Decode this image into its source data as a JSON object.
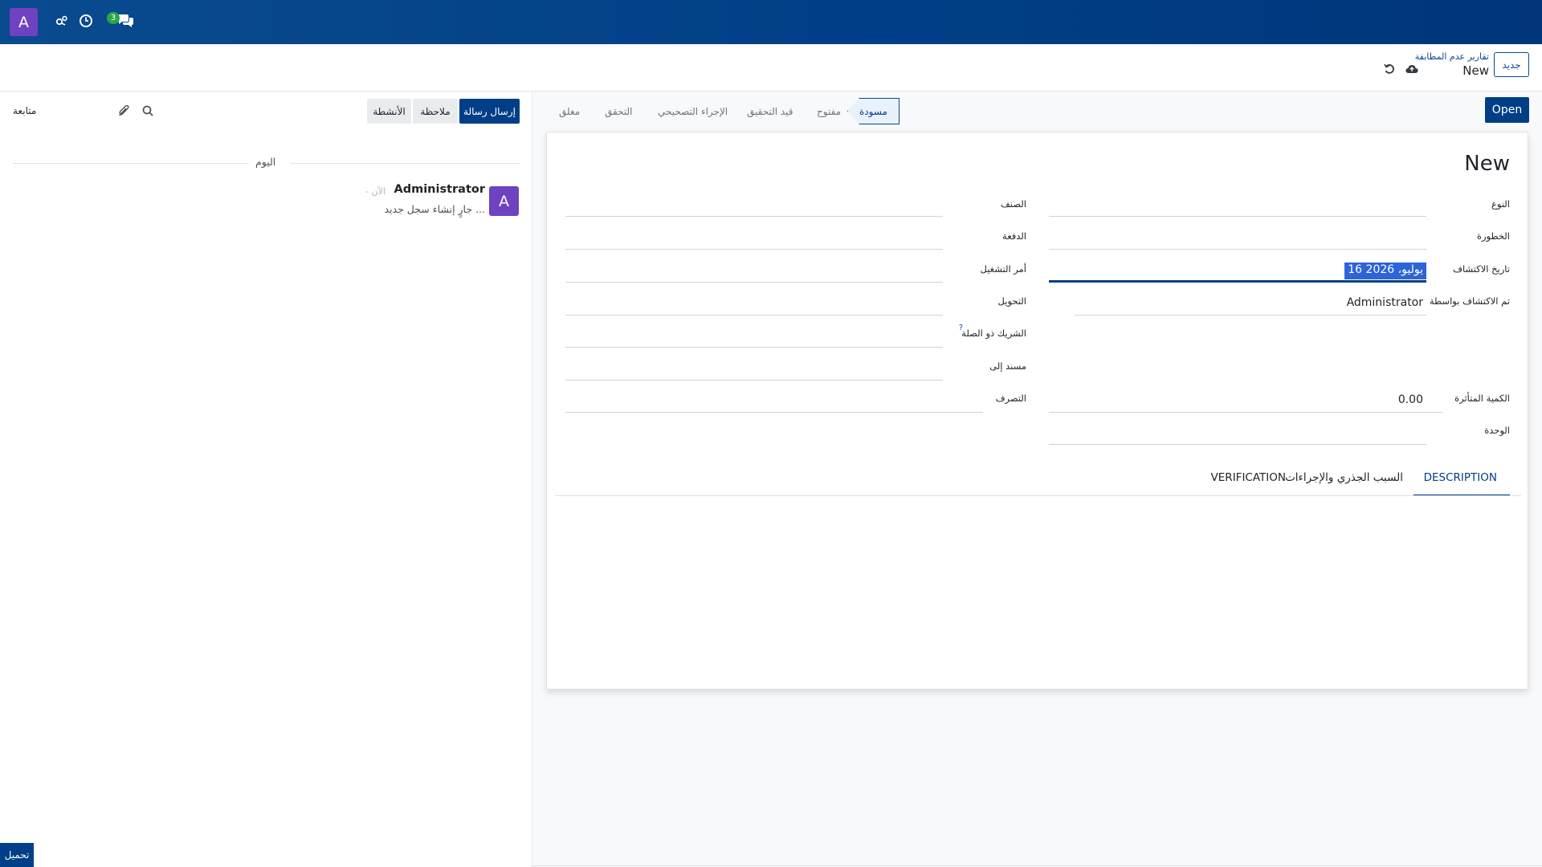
{
  "navbar": {
    "user_initial": "A",
    "messages_badge": "3"
  },
  "control_panel": {
    "new_button": "جديد",
    "breadcrumb_parent": "تقارير عدم المطابقة",
    "breadcrumb_current": "New"
  },
  "statusbar": {
    "open_button": "Open",
    "stages": [
      "مسودة",
      "مفتوح",
      "قيد التحقيق",
      "الإجراء التصحيحي",
      "التحقق",
      "مغلق"
    ],
    "active_stage": "مسودة"
  },
  "form": {
    "title": "New",
    "labels": {
      "type": "النوع",
      "severity": "الخطورة",
      "detection_date": "تاريخ الاكتشاف",
      "detected_by": "تم الاكتشاف بواسطة",
      "affected_qty": "الكمية المتأثرة",
      "uom": "الوحدة",
      "product": "الصنف",
      "lot": "الدفعة",
      "work_order": "أمر التشغيل",
      "transfer": "التحويل",
      "partner": "الشريك ذو الصلة",
      "assigned_to": "مسند إلى",
      "disposition": "التصرف"
    },
    "values": {
      "detection_date": "16 يوليو، 2026",
      "detected_by": "Administrator",
      "affected_qty": "0.00"
    },
    "help_mark": "?",
    "tabs": [
      "DESCRIPTION",
      "السبب الجذري والإجراءات",
      "VERIFICATION"
    ],
    "active_tab": "DESCRIPTION"
  },
  "chatter": {
    "send_message": "إرسال رسالة",
    "log_note": "ملاحظة",
    "activities": "الأنشطة",
    "follow": "متابعة",
    "today": "اليوم",
    "message": {
      "avatar_initial": "A",
      "author": "Administrator",
      "time": "- الآن",
      "body": "جارٍ إنشاء سجل جديد ..."
    }
  },
  "upload_button": "تحميل",
  "colors": {
    "brand": "#003f87",
    "avatar": "#6f42c1",
    "badge": "#28a745",
    "selection": "#2d64d8"
  }
}
